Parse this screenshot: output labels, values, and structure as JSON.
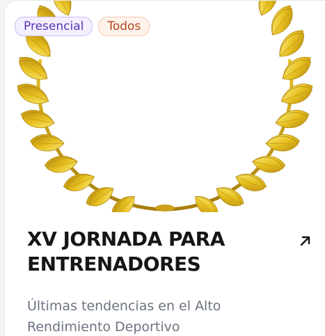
{
  "card": {
    "tags": [
      {
        "label": "Presencial"
      },
      {
        "label": "Todos"
      }
    ],
    "image_icon": "laurel-wreath",
    "title": "XV JORNADA PARA ENTRENADORES",
    "description": "Últimas tendencias en el Alto Rendimiento Deportivo",
    "link_icon": "arrow-up-right-icon"
  },
  "colors": {
    "gold_light": "#f7e55a",
    "gold_mid": "#e6bf1f",
    "gold_dark": "#b28810",
    "tag_presencial": "#5b32b4",
    "tag_todos": "#b1441a"
  }
}
